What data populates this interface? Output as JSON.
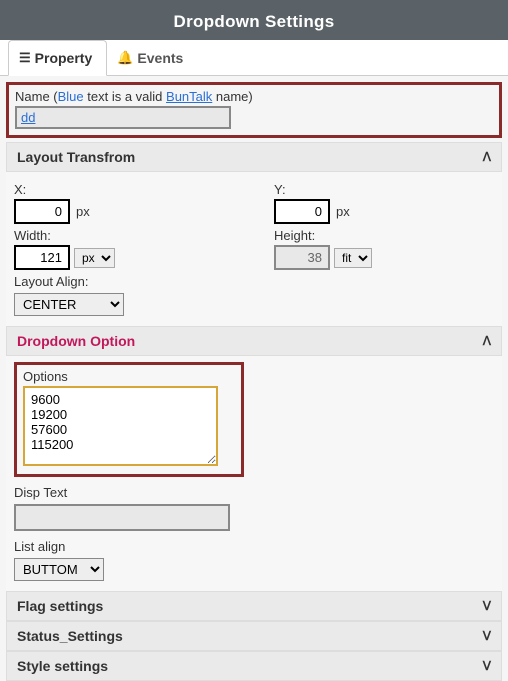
{
  "title": "Dropdown Settings",
  "tabs": {
    "property": "Property",
    "events": "Events"
  },
  "name_section": {
    "label_prefix": "Name (",
    "blue_word": "Blue",
    "label_mid": " text is a valid ",
    "link_text": "BunTalk",
    "label_suffix": " name)",
    "value": "dd"
  },
  "layout": {
    "header": "Layout Transfrom",
    "x_label": "X:",
    "x_value": "0",
    "x_unit": "px",
    "y_label": "Y:",
    "y_value": "0",
    "y_unit": "px",
    "w_label": "Width:",
    "w_value": "121",
    "w_unit": "px",
    "h_label": "Height:",
    "h_value": "38",
    "h_unit": "fit",
    "align_label": "Layout Align:",
    "align_value": "CENTER"
  },
  "dropdown": {
    "header": "Dropdown Option",
    "options_label": "Options",
    "options_text": "9600\n19200\n57600\n115200",
    "disp_label": "Disp Text",
    "disp_value": "",
    "list_align_label": "List align",
    "list_align_value": "BUTTOM"
  },
  "collapsed": {
    "flag": "Flag settings",
    "status": "Status_Settings",
    "style": "Style settings"
  }
}
